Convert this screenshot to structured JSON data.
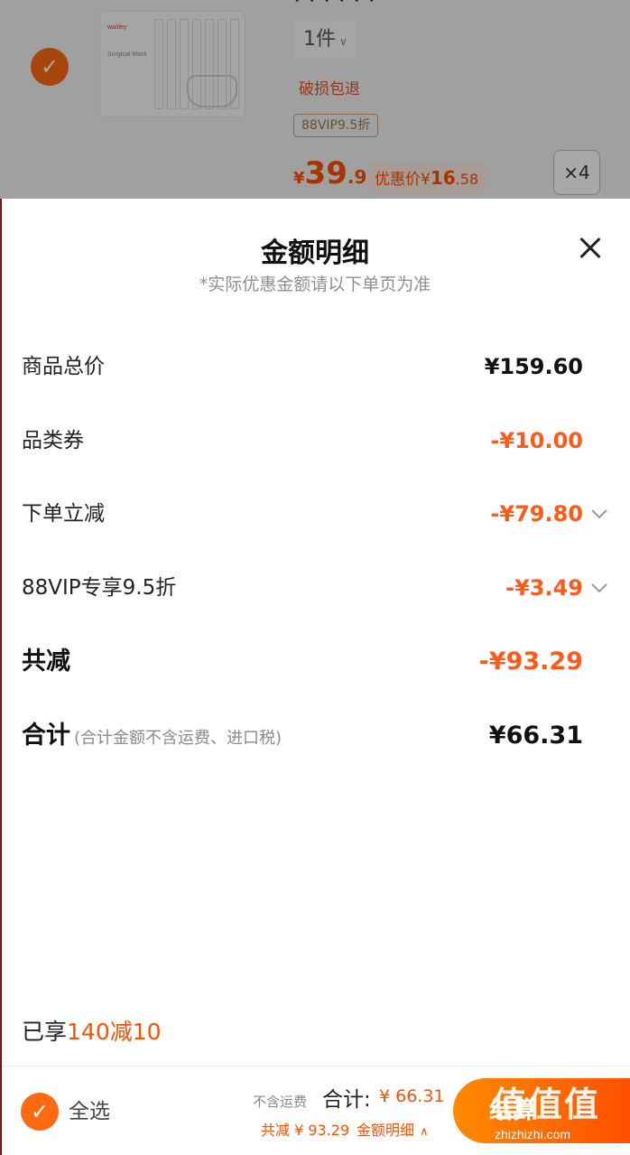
{
  "background_cart": {
    "item_checked": true,
    "brand_text": "waitley",
    "product_name": "Surgical Mask",
    "top_text": "· · · · · ·",
    "quantity": "1件",
    "return_tag": "破损包退",
    "vip_tag": "88VIP9.5折",
    "price_currency": "¥",
    "price_int": "39",
    "price_dec": ".9",
    "discount_label": "优惠价",
    "discount_currency": "¥",
    "discount_int": "16",
    "discount_dec": ".58",
    "qty_badge": "×4"
  },
  "sheet": {
    "title": "金额明细",
    "subtitle": "*实际优惠金额请以下单页为准",
    "rows": [
      {
        "label": "商品总价",
        "value": "¥159.60"
      },
      {
        "label": "品类券",
        "value": "-¥10.00"
      },
      {
        "label": "下单立减",
        "value": "-¥79.80"
      },
      {
        "label": "88VIP专享9.5折",
        "value": "-¥3.49"
      },
      {
        "label": "共减",
        "value": "-¥93.29"
      },
      {
        "label": "合计",
        "sublabel": "(合计金额不含运费、进口税)",
        "value": "¥66.31"
      }
    ],
    "promo_prefix": "已享",
    "promo_highlight": "140减10"
  },
  "bottom_bar": {
    "select_all_label": "全选",
    "shipping_note": "不含运费",
    "total_label": "合计:",
    "total_value": "¥ 66.31",
    "saved_text": "共减 ¥ 93.29",
    "detail_link": "金额明细",
    "checkout_label": "结算",
    "watermark": "值值值",
    "watermark_url": "zhizhizhi.com"
  },
  "colors": {
    "accent": "#ff5000",
    "discount_orange": "#ff5a1a",
    "vip_gold": "#a57845"
  }
}
